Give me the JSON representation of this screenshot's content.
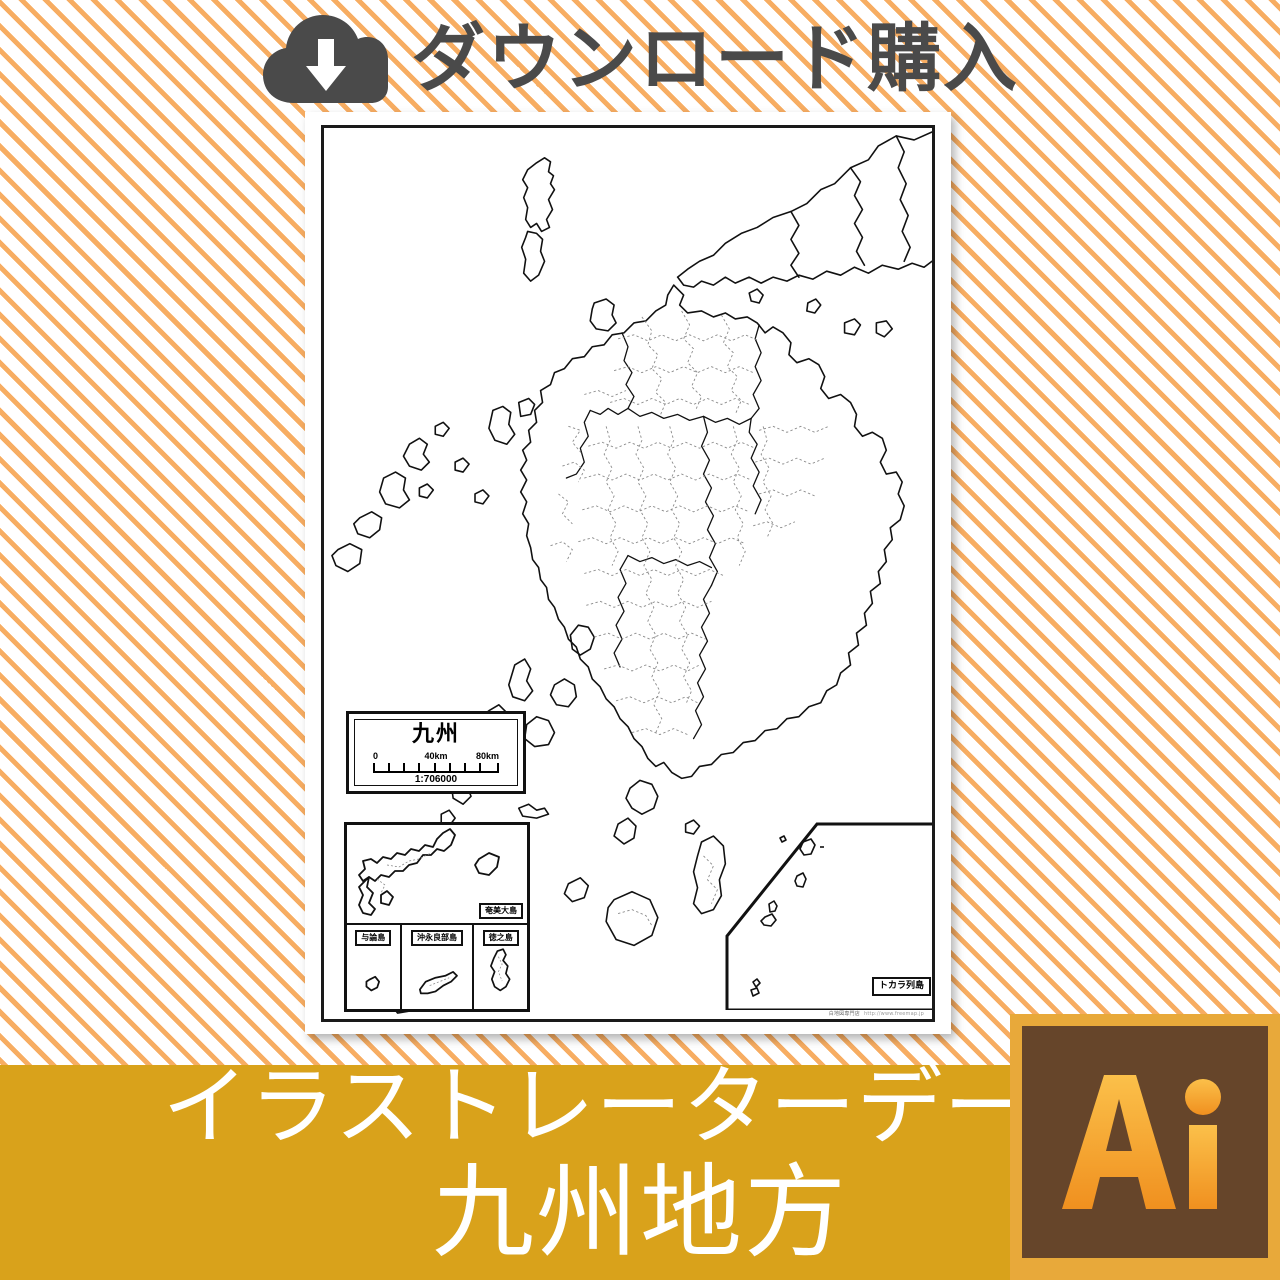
{
  "header": {
    "icon": "cloud-download-icon",
    "title": "ダウンロード購入"
  },
  "map": {
    "title_block": {
      "title": "九州",
      "scale_labels": [
        "0",
        "40km",
        "80km"
      ],
      "scale_ratio": "1:706000"
    },
    "insets": [
      {
        "id": "amami-oshima",
        "label": "奄美大島"
      },
      {
        "id": "yoron-to",
        "label": "与論島"
      },
      {
        "id": "okinoerabu-jima",
        "label": "沖永良部島"
      },
      {
        "id": "tokunoshima",
        "label": "徳之島"
      },
      {
        "id": "tokara-retto",
        "label": "トカラ列島"
      }
    ],
    "credit": {
      "name": "白地図専門店",
      "url": "http://www.freemap.jp"
    }
  },
  "banner": {
    "line1": "イラストレーターデータ",
    "line2": "九州地方"
  },
  "badge": {
    "name": "adobe-illustrator-badge",
    "label": "Ai"
  },
  "colors": {
    "stripe_orange": "#f7ad62",
    "background_white": "#ffffff",
    "banner_gold": "#d9a21b",
    "badge_border": "#e8a93a",
    "badge_fill": "#66452a",
    "badge_text": "#f5a623",
    "header_gray": "#4a4a4a",
    "map_ink": "#111111"
  }
}
